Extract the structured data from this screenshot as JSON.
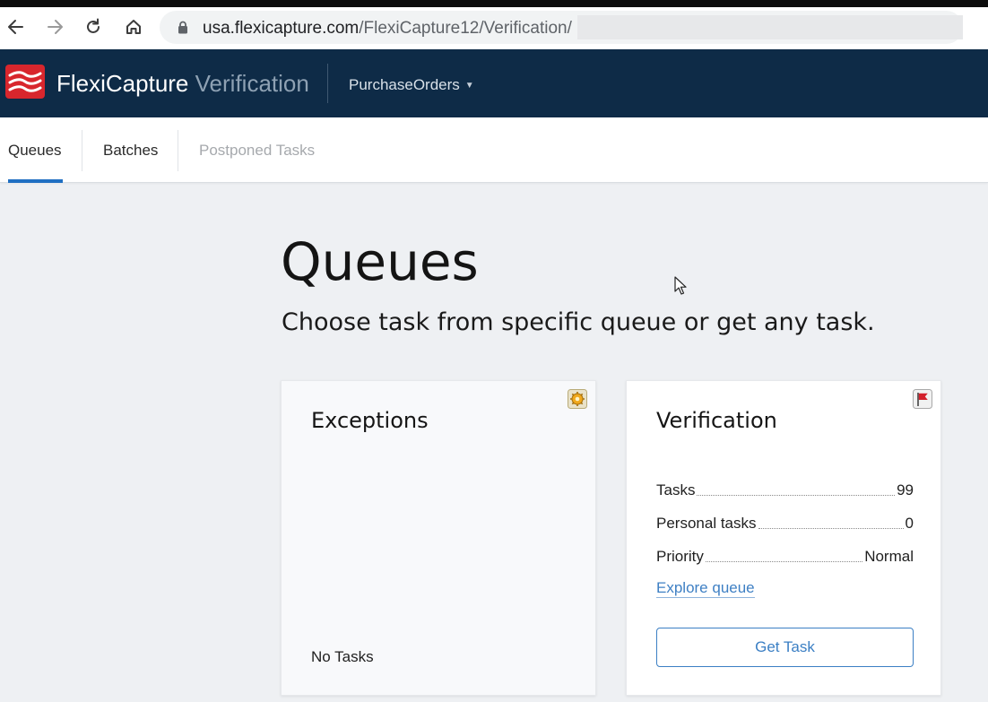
{
  "browser": {
    "url_host": "usa.flexicapture.com",
    "url_path": "/FlexiCapture12/Verification/",
    "icons": [
      "back-arrow-icon",
      "forward-arrow-icon",
      "reload-icon",
      "home-icon",
      "lock-icon"
    ]
  },
  "header": {
    "brand_primary": "FlexiCapture",
    "brand_secondary": "Verification",
    "project": "PurchaseOrders",
    "background": "#0e2b47"
  },
  "tabs": [
    {
      "label": "Queues",
      "active": true
    },
    {
      "label": "Batches",
      "active": false
    },
    {
      "label": "Postponed Tasks",
      "active": false,
      "disabled": true
    }
  ],
  "main": {
    "title": "Queues",
    "subtitle": "Choose task from specific queue or get any task."
  },
  "cards": {
    "exceptions": {
      "title": "Exceptions",
      "icon": "gear-icon",
      "empty_text": "No Tasks"
    },
    "verification": {
      "title": "Verification",
      "icon": "flag-icon",
      "stats": [
        {
          "label": "Tasks",
          "value": "99"
        },
        {
          "label": "Personal tasks",
          "value": "0"
        },
        {
          "label": "Priority",
          "value": "Normal"
        }
      ],
      "explore_link": "Explore queue",
      "button": "Get Task"
    }
  },
  "colors": {
    "accent": "#1f6fc2",
    "link": "#3f80c4",
    "page_background": "#eef0f3"
  }
}
